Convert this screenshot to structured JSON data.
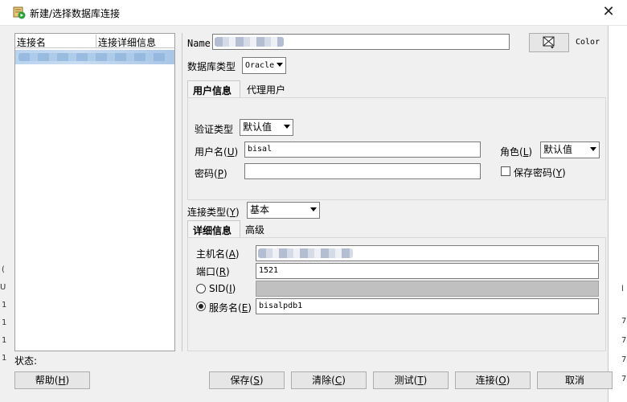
{
  "window": {
    "title": "新建/选择数据库连接"
  },
  "conn_list": {
    "col_name": "连接名",
    "col_detail": "连接详细信息"
  },
  "form": {
    "name_label": "Name",
    "color_label": "Color",
    "db_type_label": "数据库类型",
    "db_type_value": "Oracle",
    "tabs": [
      "用户信息",
      "代理用户"
    ],
    "auth_type_label": "验证类型",
    "auth_type_value": "默认值",
    "username_label": "用户名",
    "username_key": "U",
    "username_value": "bisal",
    "role_label": "角色",
    "role_key": "L",
    "role_value": "默认值",
    "password_label": "密码",
    "password_key": "P",
    "save_password_label": "保存密码",
    "save_password_key": "Y",
    "conn_type_label": "连接类型",
    "conn_type_key": "Y",
    "conn_type_value": "基本",
    "detail_tabs": [
      "详细信息",
      "高级"
    ],
    "host_label": "主机名",
    "host_key": "A",
    "port_label": "端口",
    "port_key": "R",
    "port_value": "1521",
    "sid_label": "SID",
    "sid_key": "I",
    "service_label": "服务名",
    "service_key": "E",
    "service_value": "bisalpdb1"
  },
  "status_label": "状态:",
  "buttons": {
    "help": "帮助",
    "help_key": "H",
    "save": "保存",
    "save_key": "S",
    "clear": "清除",
    "clear_key": "C",
    "test": "测试",
    "test_key": "T",
    "connect": "连接",
    "connect_key": "O",
    "cancel": "取消"
  },
  "background_fragments": {
    "right": [
      "l",
      "7",
      "7",
      "7",
      "7"
    ],
    "left": [
      "(",
      "U",
      "1",
      "1",
      "1",
      "1"
    ]
  }
}
